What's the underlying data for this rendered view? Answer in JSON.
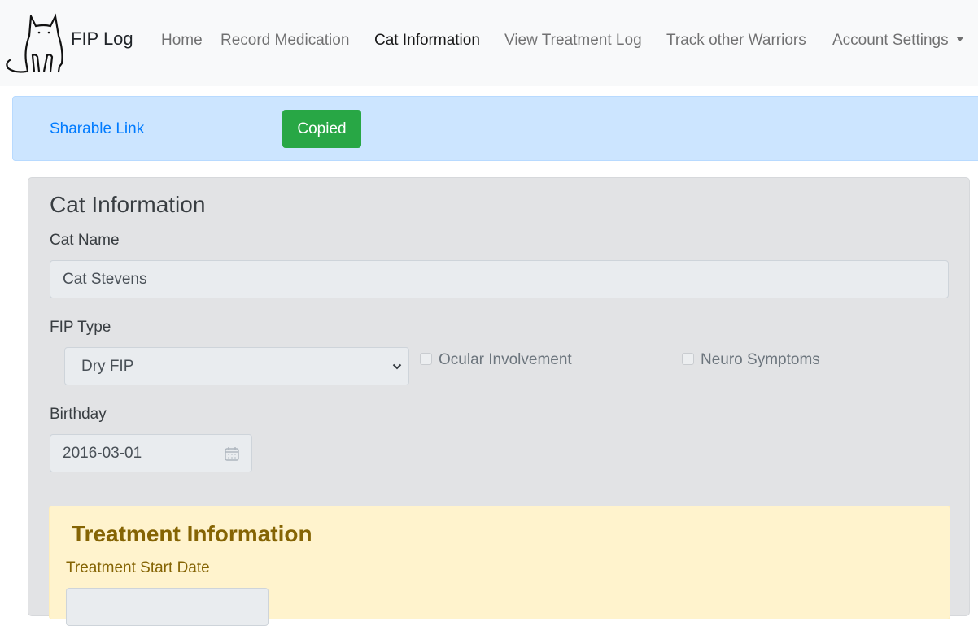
{
  "brand": {
    "name": "FIP Log",
    "logo_icon": "cat-outline-icon"
  },
  "nav": {
    "items": [
      {
        "label": "Home",
        "active": false
      },
      {
        "label": "Record Medication",
        "active": false
      },
      {
        "label": "Cat Information",
        "active": true
      },
      {
        "label": "View Treatment Log",
        "active": false
      },
      {
        "label": "Track other Warriors",
        "active": false
      },
      {
        "label": "Account Settings",
        "active": false,
        "dropdown": true
      }
    ]
  },
  "share": {
    "link_label": "Sharable Link",
    "copied_label": "Copied"
  },
  "cat_info": {
    "title": "Cat Information",
    "name_label": "Cat Name",
    "name_value": "Cat Stevens",
    "fip_type_label": "FIP Type",
    "fip_type_value": "Dry FIP",
    "ocular_label": "Ocular Involvement",
    "ocular_checked": false,
    "neuro_label": "Neuro Symptoms",
    "neuro_checked": false,
    "birthday_label": "Birthday",
    "birthday_value": "2016-03-01"
  },
  "treatment": {
    "title": "Treatment Information",
    "start_date_label": "Treatment Start Date"
  },
  "colors": {
    "info_alert": "#cce5ff",
    "link": "#007bff",
    "success": "#28a745",
    "card": "#e2e3e5",
    "warning_bg": "#fff3cd",
    "warning_text": "#856404"
  }
}
